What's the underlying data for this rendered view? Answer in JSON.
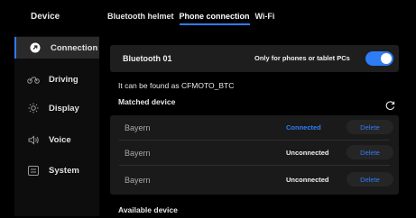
{
  "header": {
    "device_title": "Device",
    "tabs": [
      {
        "label": "Bluetooth helmet",
        "active": false
      },
      {
        "label": "Phone connection",
        "active": true
      },
      {
        "label": "Wi-Fi",
        "active": false
      }
    ]
  },
  "sidebar": {
    "items": [
      {
        "label": "Connection",
        "icon": "connection-icon",
        "active": true
      },
      {
        "label": "Driving",
        "icon": "motorcycle-icon",
        "active": false
      },
      {
        "label": "Display",
        "icon": "brightness-icon",
        "active": false
      },
      {
        "label": "Voice",
        "icon": "speaker-icon",
        "active": false
      },
      {
        "label": "System",
        "icon": "system-icon",
        "active": false
      }
    ]
  },
  "bluetooth": {
    "name": "Bluetooth 01",
    "only_label": "Only for phones or tablet PCs",
    "toggle_on": true
  },
  "found_text": "It can be found as CFMOTO_BTC",
  "matched_label": "Matched device",
  "devices": [
    {
      "name": "Bayern",
      "status": "Connected",
      "action": "Delete"
    },
    {
      "name": "Bayern",
      "status": "Unconnected",
      "action": "Delete"
    },
    {
      "name": "Bayern",
      "status": "Unconnected",
      "action": "Delete"
    }
  ],
  "available_label": "Available device",
  "colors": {
    "accent": "#2f7cf6",
    "background": "#000000",
    "panel": "#1e1e1e"
  }
}
